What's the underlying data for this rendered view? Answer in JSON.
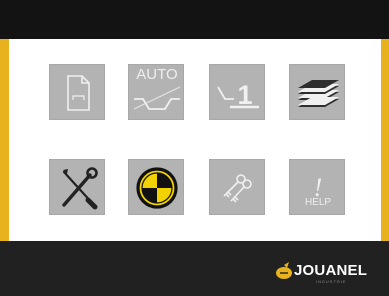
{
  "tiles": {
    "auto_label": "AUTO",
    "number_label": "1",
    "help_mark": "!",
    "help_label": "HELP"
  },
  "brand": {
    "name": "JOUANEL",
    "tagline": "INDUSTRIE"
  },
  "colors": {
    "frame": "#e8b21e",
    "bars": "#131313",
    "tile": "#b3b3b3",
    "icon": "#f0f0f0",
    "target_yellow": "#f2d200"
  },
  "icons": [
    "document-icon",
    "auto-bend-icon",
    "single-bend-icon",
    "layers-icon",
    "tools-icon",
    "calibration-target-icon",
    "keys-icon",
    "help-icon"
  ]
}
